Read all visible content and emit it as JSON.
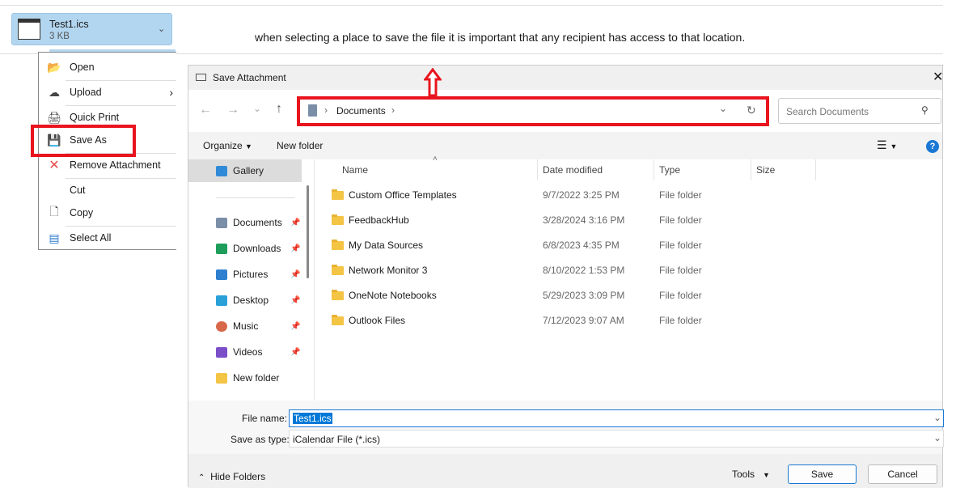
{
  "attachment": {
    "name": "Test1.ics",
    "size": "3 KB"
  },
  "note": "when selecting a place to save the file it is important that any recipient has access to that location.",
  "menu": [
    {
      "icon": "open-folder-icon",
      "label": "Open"
    },
    {
      "icon": "cloud-upload-icon",
      "label": "Upload",
      "submenu": true
    },
    {
      "icon": "printer-icon",
      "label": "Quick Print"
    },
    {
      "icon": "save-as-icon",
      "label": "Save As"
    },
    {
      "icon": "close-x-icon",
      "label": "Remove Attachment"
    },
    {
      "icon": "",
      "label": "Cut"
    },
    {
      "icon": "copy-icon",
      "label": "Copy"
    },
    {
      "icon": "select-all-icon",
      "label": "Select All"
    }
  ],
  "dialog": {
    "title": "Save Attachment",
    "breadcrumb": "Documents",
    "search_placeholder": "Search Documents",
    "organize": "Organize",
    "new_folder": "New folder",
    "columns": [
      "Name",
      "Date modified",
      "Type",
      "Size"
    ],
    "files": [
      {
        "name": "Custom Office Templates",
        "date": "9/7/2022 3:25 PM",
        "type": "File folder"
      },
      {
        "name": "FeedbackHub",
        "date": "3/28/2024 3:16 PM",
        "type": "File folder"
      },
      {
        "name": "My Data Sources",
        "date": "6/8/2023 4:35 PM",
        "type": "File folder"
      },
      {
        "name": "Network Monitor 3",
        "date": "8/10/2022 1:53 PM",
        "type": "File folder"
      },
      {
        "name": "OneNote Notebooks",
        "date": "5/29/2023 3:09 PM",
        "type": "File folder"
      },
      {
        "name": "Outlook Files",
        "date": "7/12/2023 9:07 AM",
        "type": "File folder"
      }
    ],
    "nav": [
      {
        "label": "Gallery",
        "color": "#2f8ad8"
      },
      {
        "label": "Documents",
        "color": "#7a8ea8"
      },
      {
        "label": "Downloads",
        "color": "#1e9e5a"
      },
      {
        "label": "Pictures",
        "color": "#2f7fd0"
      },
      {
        "label": "Desktop",
        "color": "#29a0d8"
      },
      {
        "label": "Music",
        "color": "#d8684a"
      },
      {
        "label": "Videos",
        "color": "#7a4fc8"
      },
      {
        "label": "New folder",
        "color": "#f4c445"
      }
    ],
    "file_name_label": "File name:",
    "file_name": "Test1.ics",
    "save_type_label": "Save as type:",
    "save_type": "iCalendar File (*.ics)",
    "hide_folders": "Hide Folders",
    "tools": "Tools",
    "save": "Save",
    "cancel": "Cancel"
  },
  "colors": {
    "highlight": "#e8141e",
    "chip": "#b3d6f0",
    "selection": "#0078d7"
  }
}
